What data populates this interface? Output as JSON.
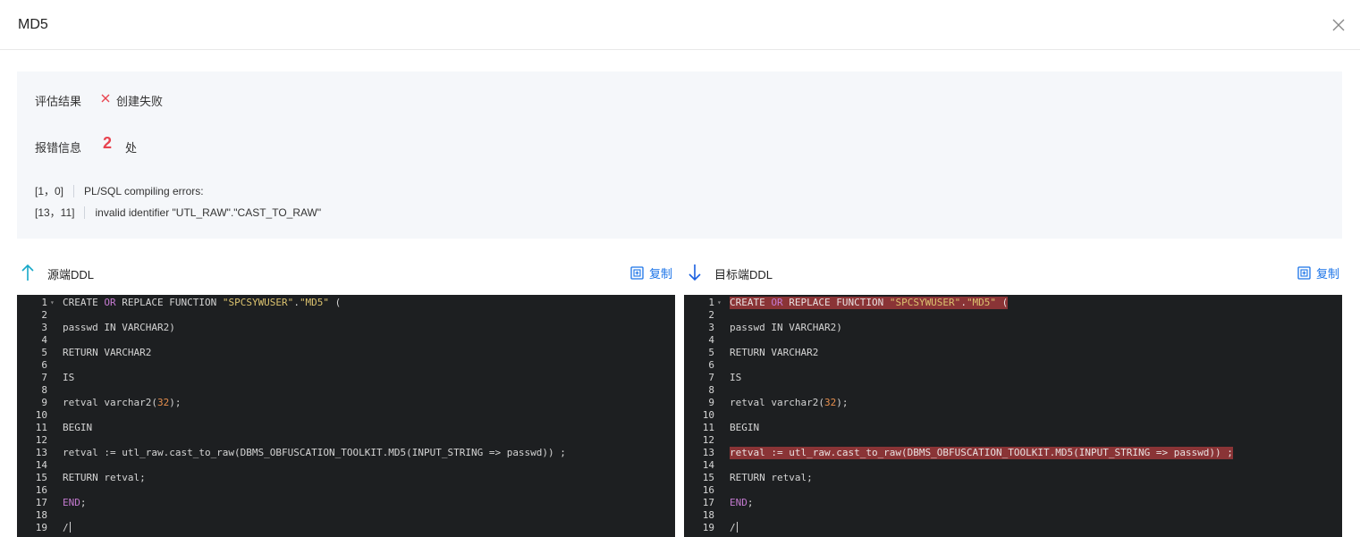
{
  "dialog": {
    "title": "MD5",
    "close_icon": "close-icon"
  },
  "result": {
    "eval_label": "评估结果",
    "status_text": "创建失败",
    "status_color": "#e8434f",
    "error_label": "报错信息",
    "error_count": "2",
    "error_unit": "处",
    "errors": [
      {
        "pos": "[1，0]",
        "message": "PL/SQL compiling errors:"
      },
      {
        "pos": "[13，11]",
        "message": "invalid identifier \"UTL_RAW\".\"CAST_TO_RAW\""
      }
    ]
  },
  "source": {
    "title": "源端DDL",
    "icon": "arrow-up-icon",
    "copy_label": "复制"
  },
  "target": {
    "title": "目标端DDL",
    "icon": "arrow-down-icon",
    "copy_label": "复制"
  },
  "code_lines": [
    {
      "n": "1",
      "text": "CREATE OR REPLACE FUNCTION \"SPCSYWUSER\".\"MD5\" ("
    },
    {
      "n": "2",
      "text": ""
    },
    {
      "n": "3",
      "text": "passwd IN VARCHAR2)"
    },
    {
      "n": "4",
      "text": ""
    },
    {
      "n": "5",
      "text": "RETURN VARCHAR2"
    },
    {
      "n": "6",
      "text": ""
    },
    {
      "n": "7",
      "text": "IS"
    },
    {
      "n": "8",
      "text": ""
    },
    {
      "n": "9",
      "text": "retval varchar2(32);"
    },
    {
      "n": "10",
      "text": ""
    },
    {
      "n": "11",
      "text": "BEGIN"
    },
    {
      "n": "12",
      "text": ""
    },
    {
      "n": "13",
      "text": "retval := utl_raw.cast_to_raw(DBMS_OBFUSCATION_TOOLKIT.MD5(INPUT_STRING => passwd)) ;"
    },
    {
      "n": "14",
      "text": ""
    },
    {
      "n": "15",
      "text": "RETURN retval;"
    },
    {
      "n": "16",
      "text": ""
    },
    {
      "n": "17",
      "text": "END;"
    },
    {
      "n": "18",
      "text": ""
    },
    {
      "n": "19",
      "text": "/"
    }
  ],
  "target_error_lines": [
    "1",
    "13"
  ],
  "colors": {
    "accent": "#1a73e8",
    "error": "#e8434f",
    "editor_bg": "#1d1f21",
    "error_line_bg": "#8a3436",
    "keyword": "#c47ad0",
    "string": "#dbc26f",
    "number": "#e8904e"
  }
}
